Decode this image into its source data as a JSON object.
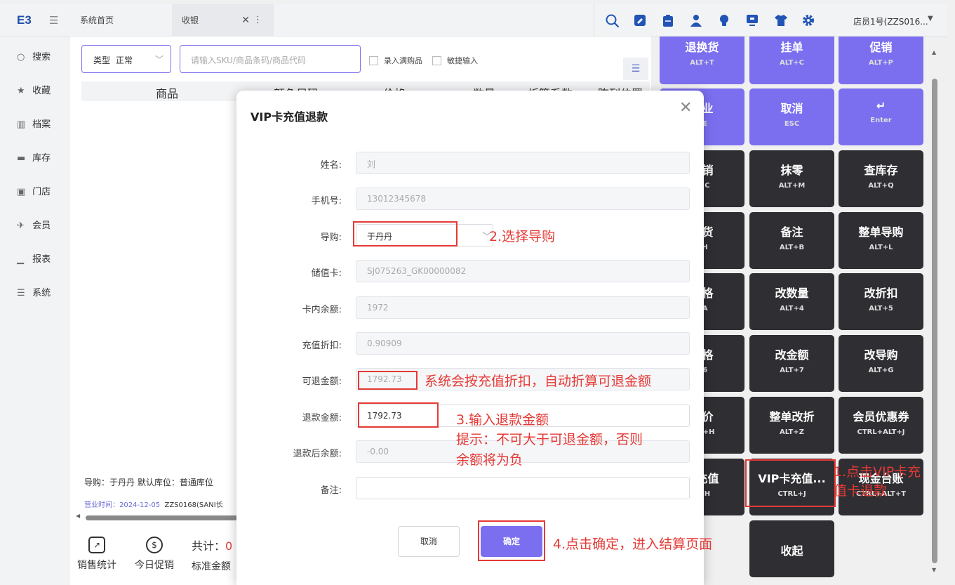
{
  "app": {
    "logo": "E3",
    "menu_icon": "menu-icon"
  },
  "tabs": [
    {
      "label": "系统首页"
    },
    {
      "label": "收银",
      "close": "✕",
      "more": "⋮"
    }
  ],
  "toolbar_icons": [
    "search-icon",
    "edit-icon",
    "clipboard-icon",
    "user-icon",
    "lightbulb-icon",
    "monitor-icon",
    "shirt-icon",
    "gear-icon"
  ],
  "user": {
    "name": "店员1号(ZZS016...",
    "caret": "▼"
  },
  "sidebar": {
    "items": [
      {
        "label": "搜索",
        "icon": "○"
      },
      {
        "label": "收藏",
        "icon": "★"
      },
      {
        "label": "档案",
        "icon": "▥"
      },
      {
        "label": "库存",
        "icon": "▬"
      },
      {
        "label": "门店",
        "icon": "▣"
      },
      {
        "label": "会员",
        "icon": "✈"
      },
      {
        "label": "报表",
        "icon": "▁"
      },
      {
        "label": "系统",
        "icon": "☰"
      }
    ]
  },
  "cash": {
    "type_label": "类型",
    "type_value": "正常",
    "sku_placeholder": "请输入SKU/商品条码/商品代码",
    "check_full": "录入满购品",
    "check_quick": "敏捷输入",
    "columns": [
      "商品",
      "颜色尺码",
      "价格",
      "数量",
      "折算系数",
      "陈列位置"
    ],
    "bottom_info": "导购：于丹丹  默认库位：普通库位",
    "biz_time_label": "营业时间：2024-12-05",
    "biz_time_value": "ZZS0168(SANI长",
    "footer": [
      {
        "label": "销售统计",
        "icon": "↗"
      },
      {
        "label": "今日促销",
        "icon": "$"
      }
    ],
    "total_label": "共计：",
    "total_value": "0",
    "std_label": "标准金额"
  },
  "panel_keys": [
    {
      "label": "退换货",
      "shortcut": "ALT+T",
      "style": "purple"
    },
    {
      "label": "挂单",
      "shortcut": "ALT+C",
      "style": "purple"
    },
    {
      "label": "促销",
      "shortcut": "ALT+P",
      "style": "purple"
    },
    {
      "label": "营业",
      "shortcut": "+E",
      "style": "purple"
    },
    {
      "label": "取消",
      "shortcut": "ESC",
      "style": "purple"
    },
    {
      "label": "↵",
      "shortcut": "Enter",
      "style": "purple"
    },
    {
      "label": "促销",
      "shortcut": "L+C",
      "style": "dark"
    },
    {
      "label": "抹零",
      "shortcut": "ALT+M",
      "style": "dark"
    },
    {
      "label": "查库存",
      "shortcut": "ALT+Q",
      "style": "dark"
    },
    {
      "label": "退货",
      "shortcut": "+H",
      "style": "dark"
    },
    {
      "label": "备注",
      "shortcut": "ALT+B",
      "style": "dark"
    },
    {
      "label": "整单导购",
      "shortcut": "ALT+L",
      "style": "dark"
    },
    {
      "label": "规格",
      "shortcut": "+A",
      "style": "dark"
    },
    {
      "label": "改数量",
      "shortcut": "ALT+4",
      "style": "dark"
    },
    {
      "label": "改折扣",
      "shortcut": "ALT+5",
      "style": "dark"
    },
    {
      "label": "价格",
      "shortcut": "+6",
      "style": "dark"
    },
    {
      "label": "改金额",
      "shortcut": "ALT+7",
      "style": "dark"
    },
    {
      "label": "改导购",
      "shortcut": "ALT+G",
      "style": "dark"
    },
    {
      "label": "改价",
      "shortcut": "ALT+H",
      "style": "dark"
    },
    {
      "label": "整单改折",
      "shortcut": "ALT+Z",
      "style": "dark"
    },
    {
      "label": "会员优惠券",
      "shortcut": "CTRL+ALT+J",
      "style": "dark"
    },
    {
      "label": "卡充值",
      "shortcut": "L+H",
      "style": "dark"
    },
    {
      "label": "VIP卡充值...",
      "shortcut": "CTRL+J",
      "style": "dark"
    },
    {
      "label": "现金台账",
      "shortcut": "CTRL+ALT+T",
      "style": "dark"
    },
    {
      "label": "",
      "shortcut": "",
      "style": "dark"
    },
    {
      "label": "收起",
      "shortcut": "",
      "style": "dark"
    }
  ],
  "modal": {
    "title": "VIP卡充值退款",
    "close": "✕",
    "fields": [
      {
        "label": "姓名:",
        "value": "刘"
      },
      {
        "label": "手机号:",
        "value": "13012345678"
      },
      {
        "label": "导购:",
        "value": "于丹丹"
      },
      {
        "label": "储值卡:",
        "value": "SJ075263_GK00000082"
      },
      {
        "label": "卡内余额:",
        "value": "1972"
      },
      {
        "label": "充值折扣:",
        "value": "0.90909"
      },
      {
        "label": "可退金额:",
        "value": "1792.73"
      },
      {
        "label": "退款金额:",
        "value": "1792.73"
      },
      {
        "label": "退款后余额:",
        "value": "-0.00"
      },
      {
        "label": "备注:",
        "value": ""
      }
    ],
    "cancel": "取消",
    "confirm": "确定"
  },
  "annotations": {
    "step1": "1.点击VIP卡充",
    "step1_b": "值卡退款",
    "step2": "2.选择导购",
    "auto_calc": "系统会按充值折扣，自动折算可退金额",
    "step3": "3.输入退款金额",
    "hint": "提示：不可大于可退金额，否则",
    "hint_b": "余额将为负",
    "step4": "4.点击确定，进入结算页面"
  }
}
